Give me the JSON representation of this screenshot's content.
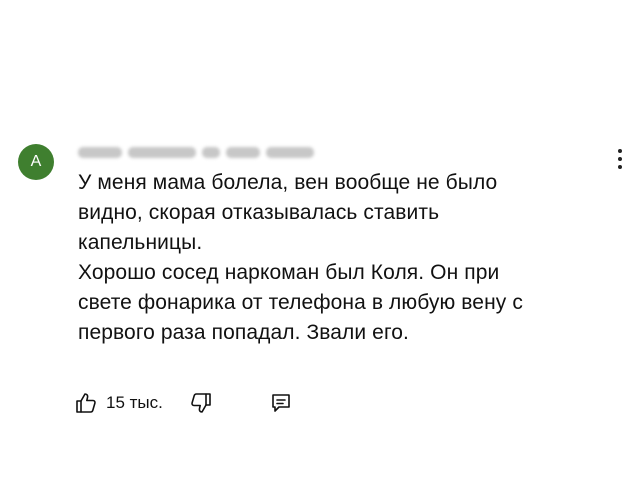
{
  "author": {
    "avatar_initial": "A",
    "name_redacted": true
  },
  "comment": {
    "paragraphs": [
      "У меня мама болела, вен вообще не было\nвидно, скорая отказывалась ставить\nкапельницы.",
      "Хорошо сосед наркоман был Коля. Он при\nсвете фонарика от телефона в любую вену с\nпервого раза попадал. Звали его."
    ]
  },
  "actions": {
    "like_count": "15 тыс.",
    "like_icon": "thumb-up-icon",
    "dislike_icon": "thumb-down-icon",
    "reply_icon": "comment-icon",
    "menu_icon": "kebab-menu-icon"
  },
  "colors": {
    "avatar_bg": "#3f7f2f",
    "text": "#111111",
    "background": "#ffffff"
  }
}
